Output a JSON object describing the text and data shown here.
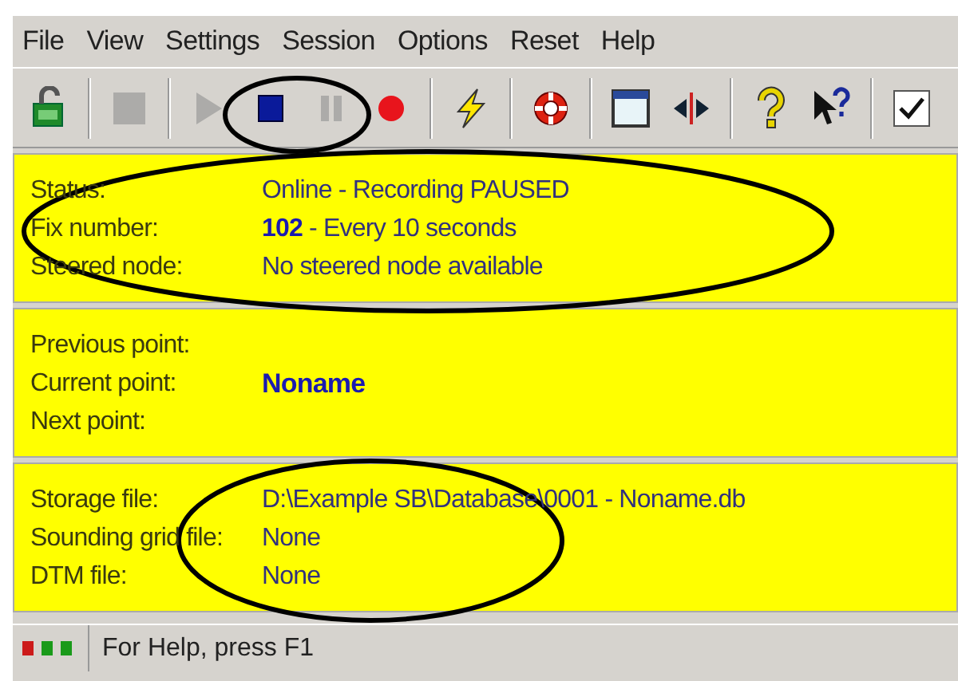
{
  "menu": [
    {
      "label": "File"
    },
    {
      "label": "View"
    },
    {
      "label": "Settings"
    },
    {
      "label": "Session"
    },
    {
      "label": "Options"
    },
    {
      "label": "Reset"
    },
    {
      "label": "Help"
    }
  ],
  "toolbar": [
    {
      "kind": "lock",
      "disabled": false
    },
    {
      "kind": "sep"
    },
    {
      "kind": "blank",
      "disabled": true
    },
    {
      "kind": "sep"
    },
    {
      "kind": "play",
      "disabled": true
    },
    {
      "kind": "stop",
      "disabled": false
    },
    {
      "kind": "pause",
      "disabled": true
    },
    {
      "kind": "record",
      "disabled": false
    },
    {
      "kind": "sep"
    },
    {
      "kind": "bolt",
      "disabled": false
    },
    {
      "kind": "sep"
    },
    {
      "kind": "lifebuoy",
      "disabled": false
    },
    {
      "kind": "sep"
    },
    {
      "kind": "window",
      "disabled": false
    },
    {
      "kind": "split",
      "disabled": false
    },
    {
      "kind": "sep"
    },
    {
      "kind": "help",
      "disabled": false
    },
    {
      "kind": "pointer-help",
      "disabled": false
    },
    {
      "kind": "sep"
    },
    {
      "kind": "check",
      "disabled": false
    }
  ],
  "panels": [
    {
      "rows": [
        {
          "label": "Status:",
          "value": "Online - Recording PAUSED"
        },
        {
          "label": "Fix number:",
          "value": "**102** - Every 10 seconds"
        },
        {
          "label": "Steered node:",
          "value": "No steered node available"
        }
      ]
    },
    {
      "rows": [
        {
          "label": "Previous point:"
        },
        {
          "label": "Current point:",
          "value": "Noname",
          "emphasis": true
        },
        {
          "label": "Next point:"
        }
      ]
    },
    {
      "rows": [
        {
          "label": "Storage file:",
          "value": "D:\\Example SB\\Database\\0001 - Noname.db"
        },
        {
          "label": "Sounding grid file:",
          "value": "None"
        },
        {
          "label": "DTM file:",
          "value": "None"
        }
      ]
    }
  ],
  "status_bar": {
    "lights": [
      {
        "color": "#cc1a1a"
      },
      {
        "color": "#1a9a1a"
      },
      {
        "color": "#1a9a1a"
      }
    ],
    "text": "For Help, press F1"
  }
}
